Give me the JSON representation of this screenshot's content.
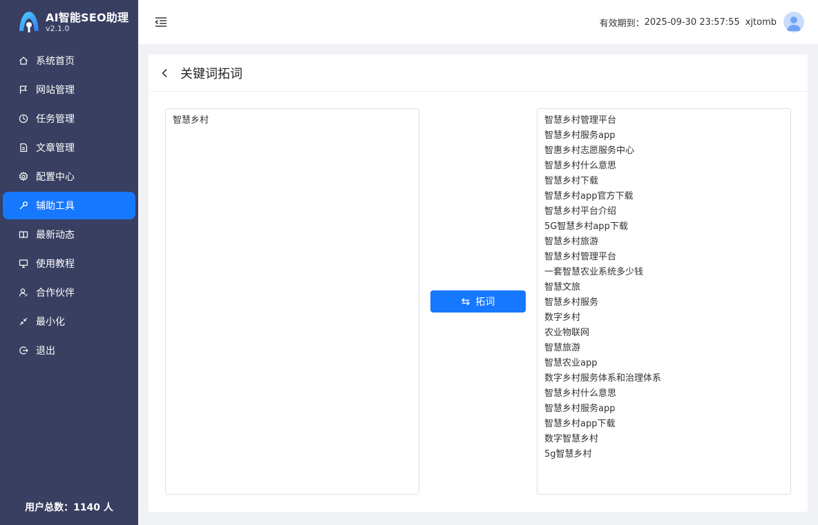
{
  "app": {
    "name": "AI智能SEO助理",
    "version": "v2.1.0"
  },
  "sidebar": {
    "items": [
      {
        "label": "系统首页",
        "icon": "home-icon"
      },
      {
        "label": "网站管理",
        "icon": "flag-icon"
      },
      {
        "label": "任务管理",
        "icon": "clock-icon"
      },
      {
        "label": "文章管理",
        "icon": "document-icon"
      },
      {
        "label": "配置中心",
        "icon": "gear-icon"
      },
      {
        "label": "辅助工具",
        "icon": "wrench-icon",
        "active": true
      },
      {
        "label": "最新动态",
        "icon": "book-icon"
      },
      {
        "label": "使用教程",
        "icon": "monitor-icon"
      },
      {
        "label": "合作伙伴",
        "icon": "partner-icon"
      },
      {
        "label": "最小化",
        "icon": "minimize-icon"
      },
      {
        "label": "退出",
        "icon": "logout-icon"
      }
    ],
    "user_total": "用户总数：1140 人"
  },
  "header": {
    "expiry_label": "有效期到：",
    "expiry_value": "2025-09-30 23:57:55",
    "username": "xjtomb"
  },
  "page": {
    "title": "关键词拓词",
    "input_text": "智慧乡村",
    "expand_button": "拓词",
    "results": [
      "智慧乡村管理平台",
      "智慧乡村服务app",
      "智惠乡村志愿服务中心",
      "智慧乡村什么意思",
      "智慧乡村下载",
      "智慧乡村app官方下载",
      "智慧乡村平台介绍",
      "5G智慧乡村app下载",
      "智慧乡村旅游",
      "智慧乡村管理平台",
      "一套智慧农业系统多少钱",
      "智慧文旅",
      "智慧乡村服务",
      "数字乡村",
      "农业物联网",
      "智慧旅游",
      "智慧农业app",
      "数字乡村服务体系和治理体系",
      "智慧乡村什么意思",
      "智慧乡村服务app",
      "智慧乡村app下载",
      "数字智慧乡村",
      "5g智慧乡村"
    ]
  },
  "colors": {
    "sidebar_bg": "#383f61",
    "accent": "#1677ff"
  }
}
